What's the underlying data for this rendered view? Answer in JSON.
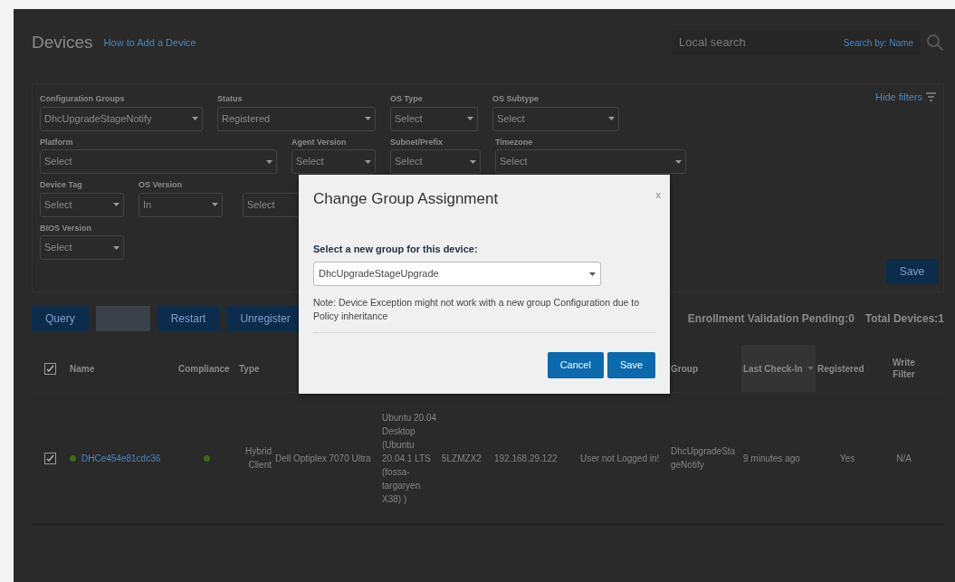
{
  "header": {
    "title": "Devices",
    "help_link": "How to Add a Device",
    "search": {
      "placeholder": "Local search",
      "search_by": "Search by: Name"
    }
  },
  "filters": {
    "hide_link": "Hide filters",
    "save": "Save",
    "rows": [
      [
        {
          "label": "Configuration Groups",
          "value": "DhcUpgradeStageNotify"
        },
        {
          "label": "Status",
          "value": "Registered"
        },
        {
          "label": "OS Type",
          "value": "Select"
        },
        {
          "label": "OS Subtype",
          "value": "Select"
        }
      ],
      [
        {
          "label": "Platform",
          "value": "Select"
        },
        {
          "label": "Agent Version",
          "value": "Select"
        },
        {
          "label": "Subnet/Prefix",
          "value": "Select"
        },
        {
          "label": "Timezone",
          "value": "Select"
        }
      ],
      [
        {
          "label": "Device Tag",
          "value": "Select"
        },
        {
          "label": "OS Version",
          "value": "In"
        },
        {
          "value": "Select"
        }
      ],
      [
        {
          "label": "BIOS Version",
          "value": "Select"
        }
      ]
    ]
  },
  "actions": [
    {
      "label": "Query",
      "disabled": false
    },
    {
      "disabled": true
    },
    {
      "label": "Restart",
      "disabled": false
    },
    {
      "label": "Unregister",
      "disabled": false
    }
  ],
  "summary": [
    "Enrollment Validation Pending:0",
    "Total Devices:1"
  ],
  "table": {
    "all_checked": true,
    "columns": [
      {
        "label": "Name",
        "sorted": false
      },
      {
        "label": "Compliance",
        "sorted": false
      },
      {
        "label": "Type",
        "sorted": false
      },
      null,
      null,
      null,
      null,
      null,
      {
        "label": "Group",
        "sorted": false
      },
      {
        "label": "Last Check-In",
        "sorted": true
      },
      {
        "label": "Registered",
        "sorted": false
      },
      {
        "label": "Write Filter",
        "sorted": false
      }
    ],
    "rows": [
      {
        "checked": true,
        "online": true,
        "compliant": true,
        "cells": [
          "DHCe454e81cdc36",
          "",
          "Hybrid Client",
          "Dell Optiplex 7070 Ultra",
          "Ubuntu 20.04 Desktop (Ubuntu 20.04.1 LTS (fossa-targaryen X38) )",
          "5LZMZX2",
          "192.168.29.122",
          "User not Logged in!",
          "DhcUpgradeStageNotify",
          "9 minutes ago",
          "Yes",
          "N/A"
        ]
      }
    ]
  },
  "dialog": {
    "title": "Change Group Assignment",
    "close": "x",
    "field_label": "Select a new group for this device:",
    "value": "DhcUpgradeStageUpgrade",
    "note": "Note: Device Exception might not work with a new group Configuration due to Policy inheritance",
    "buttons": [
      {
        "label": "Cancel"
      },
      {
        "label": "Save"
      }
    ]
  }
}
